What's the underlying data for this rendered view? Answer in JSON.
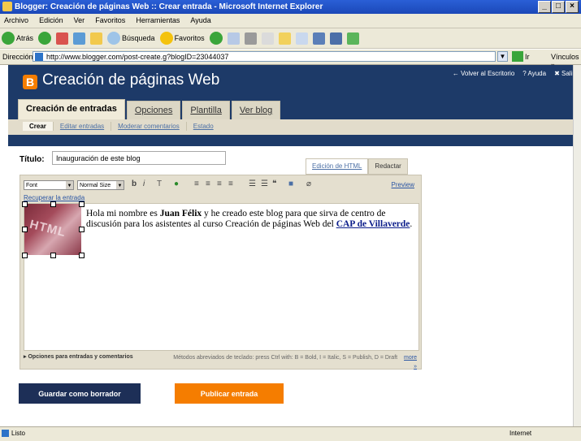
{
  "browser": {
    "title": "Blogger: Creación de páginas Web :: Crear entrada - Microsoft Internet Explorer",
    "menu": [
      "Archivo",
      "Edición",
      "Ver",
      "Favoritos",
      "Herramientas",
      "Ayuda"
    ],
    "toolbar": {
      "back": "Atrás",
      "search": "Búsqueda",
      "favorites": "Favoritos"
    },
    "address_label": "Dirección",
    "address": "http://www.blogger.com/post-create.g?blogID=23044037",
    "go_label": "Ir",
    "links_label": "Vínculos »",
    "status_left": "Listo",
    "status_right": "Internet"
  },
  "page": {
    "title": "Creación de páginas Web",
    "header_links": [
      "← Volver al Escritorio",
      "? Ayuda",
      "✖ Salir"
    ],
    "tabs": [
      "Creación de entradas",
      "Opciones",
      "Plantilla",
      "Ver blog"
    ],
    "subtabs": [
      "Crear",
      "Editar entradas",
      "Moderar comentarios",
      "Estado"
    ],
    "title_label": "Título:",
    "title_value": "Inauguración de este blog",
    "editor_tabs": [
      "Edición de HTML",
      "Redactar"
    ],
    "font_select": "Font",
    "size_select": "Normal Size",
    "preview": "Preview",
    "recover": "Recuperar la entrada",
    "image_text": "HTML",
    "body": {
      "p1": "Hola mi nombre es ",
      "name": "Juan Félix",
      "p2": " y he creado este blog para que sirva de centro de discusión para los asistentes al curso Creación de páginas Web del ",
      "link": "CAP de Villaverde",
      "p3": "."
    },
    "options": "Opciones para entradas y comentarios",
    "shortcuts": "Métodos abreviados de teclado: press Ctrl with: B = Bold, I = Italic, S = Publish, D = Draft",
    "more": "more »",
    "save_button": "Guardar como borrador",
    "publish_button": "Publicar entrada"
  }
}
